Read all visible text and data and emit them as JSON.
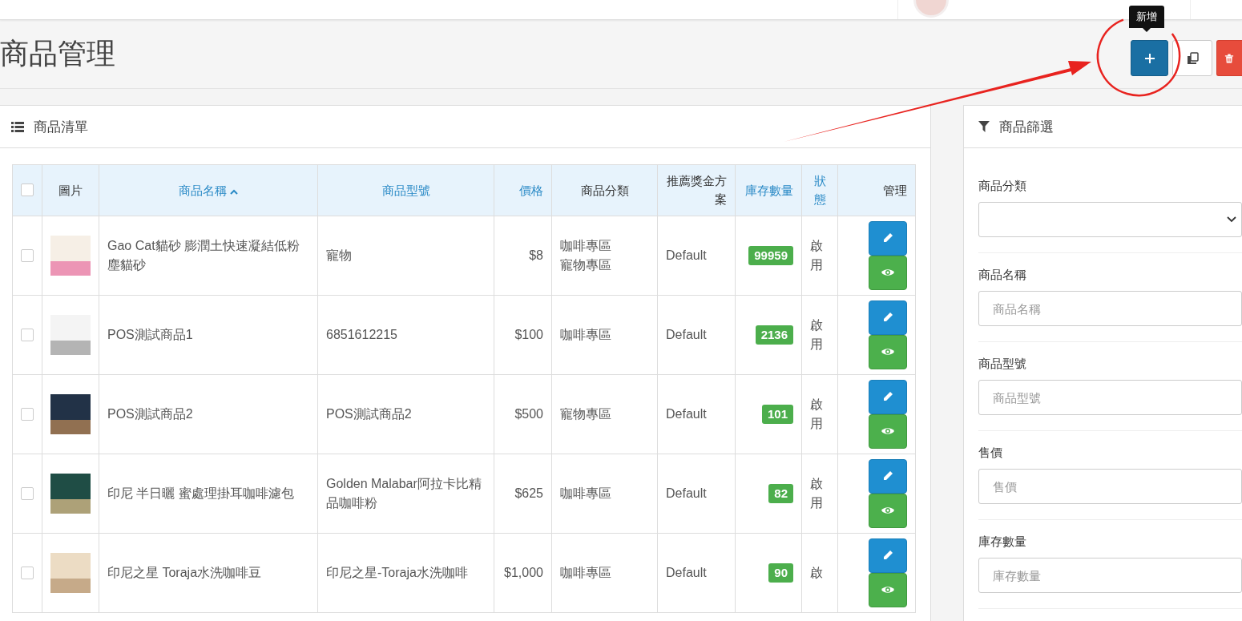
{
  "page": {
    "title": "商品管理"
  },
  "toolbar": {
    "tooltip": "新增",
    "buttons": [
      {
        "kind": "add"
      },
      {
        "kind": "copy"
      },
      {
        "kind": "delete"
      }
    ]
  },
  "list_panel": {
    "title": "商品清單"
  },
  "table": {
    "select_all": {
      "checked": false
    },
    "columns": [
      {
        "label": "圖片",
        "sortable": false,
        "sorted": false
      },
      {
        "label": "商品名稱",
        "sortable": true,
        "sorted": true
      },
      {
        "label": "商品型號",
        "sortable": true,
        "sorted": false
      },
      {
        "label": "價格",
        "sortable": true,
        "sorted": false
      },
      {
        "label": "商品分類",
        "sortable": false,
        "sorted": false
      },
      {
        "label": "推薦獎金方案",
        "sortable": false,
        "sorted": false
      },
      {
        "label": "庫存數量",
        "sortable": true,
        "sorted": false
      },
      {
        "label": "狀態",
        "sortable": true,
        "sorted": false
      },
      {
        "label": "管理",
        "sortable": false,
        "sorted": false
      }
    ],
    "rows": [
      {
        "checked": false,
        "name": "Gao Cat貓砂 膨潤土快速凝結低粉塵貓砂",
        "model": "寵物",
        "price": "$8",
        "categories": [
          "咖啡專區",
          "寵物專區"
        ],
        "bonus": "Default",
        "stock": "99959",
        "status": "啟用"
      },
      {
        "checked": false,
        "name": "POS測試商品1",
        "model": "6851612215",
        "price": "$100",
        "categories": [
          "咖啡專區"
        ],
        "bonus": "Default",
        "stock": "2136",
        "status": "啟用"
      },
      {
        "checked": false,
        "name": "POS測試商品2",
        "model": "POS測試商品2",
        "price": "$500",
        "categories": [
          "寵物專區"
        ],
        "bonus": "Default",
        "stock": "101",
        "status": "啟用"
      },
      {
        "checked": false,
        "name": "印尼 半日曬 蜜處理掛耳咖啡濾包",
        "model": "Golden Malabar阿拉卡比精品咖啡粉",
        "price": "$625",
        "categories": [
          "咖啡專區"
        ],
        "bonus": "Default",
        "stock": "82",
        "status": "啟用"
      },
      {
        "checked": false,
        "name": "印尼之星 Toraja水洗咖啡豆",
        "model": "印尼之星-Toraja水洗咖啡",
        "price": "$1,000",
        "categories": [
          "咖啡專區"
        ],
        "bonus": "Default",
        "stock": "90",
        "status": "啟"
      }
    ]
  },
  "filter_panel": {
    "title": "商品篩選",
    "fields": [
      {
        "kind": "select",
        "label": "商品分類"
      },
      {
        "kind": "input",
        "label": "商品名稱",
        "placeholder": "商品名稱"
      },
      {
        "kind": "input",
        "label": "商品型號",
        "placeholder": "商品型號"
      },
      {
        "kind": "input",
        "label": "售價",
        "placeholder": "售價"
      },
      {
        "kind": "input",
        "label": "庫存數量",
        "placeholder": "庫存數量"
      }
    ]
  }
}
